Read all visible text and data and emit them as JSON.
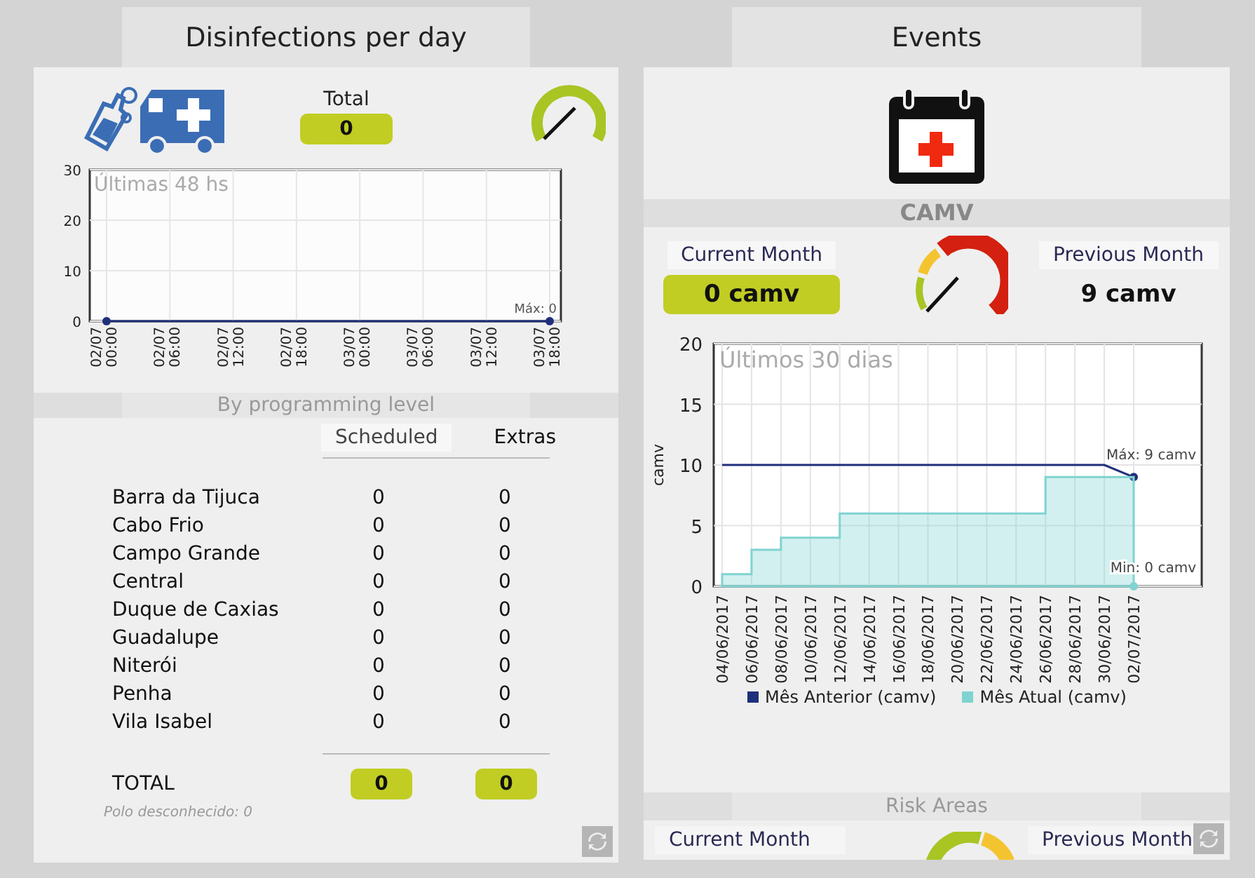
{
  "left_panel": {
    "title": "Disinfections per day",
    "total": {
      "label": "Total",
      "value": "0"
    },
    "chart_data": {
      "type": "line",
      "grid": true,
      "title": "Últimas 48 hs",
      "ylim": [
        0,
        30
      ],
      "yticks": [
        0,
        10,
        20,
        30
      ],
      "categories": [
        "02/07 00:00",
        "02/07 06:00",
        "02/07 12:00",
        "02/07 18:00",
        "03/07 00:00",
        "03/07 06:00",
        "03/07 12:00",
        "03/07 18:00"
      ],
      "series": [
        {
          "color": "#1f2f7a",
          "values": [
            0,
            0,
            0,
            0,
            0,
            0,
            0,
            0
          ]
        }
      ],
      "annotations": [
        "Máx: 0"
      ]
    },
    "section_title": "By programming level",
    "columns": [
      "Scheduled",
      "Extras"
    ],
    "rows": [
      {
        "name": "Barra da Tijuca",
        "scheduled": "0",
        "extras": "0"
      },
      {
        "name": "Cabo Frio",
        "scheduled": "0",
        "extras": "0"
      },
      {
        "name": "Campo Grande",
        "scheduled": "0",
        "extras": "0"
      },
      {
        "name": "Central",
        "scheduled": "0",
        "extras": "0"
      },
      {
        "name": "Duque de Caxias",
        "scheduled": "0",
        "extras": "0"
      },
      {
        "name": "Guadalupe",
        "scheduled": "0",
        "extras": "0"
      },
      {
        "name": "Niterói",
        "scheduled": "0",
        "extras": "0"
      },
      {
        "name": "Penha",
        "scheduled": "0",
        "extras": "0"
      },
      {
        "name": "Vila Isabel",
        "scheduled": "0",
        "extras": "0"
      }
    ],
    "total_row": {
      "label": "TOTAL",
      "scheduled": "0",
      "extras": "0"
    },
    "footnote": "Polo desconhecido: 0"
  },
  "right_panel": {
    "title": "Events",
    "section_title": "CAMV",
    "current": {
      "label": "Current Month",
      "value": "0 camv"
    },
    "previous": {
      "label": "Previous Month",
      "value": "9 camv"
    },
    "chart_data": {
      "type": "area",
      "grid": true,
      "title": "Últimos 30 dias",
      "ylabel": "camv",
      "ylim": [
        0,
        20
      ],
      "yticks": [
        0,
        5,
        10,
        15,
        20
      ],
      "categories": [
        "04/06/2017",
        "06/06/2017",
        "08/06/2017",
        "10/06/2017",
        "12/06/2017",
        "14/06/2017",
        "16/06/2017",
        "18/06/2017",
        "20/06/2017",
        "22/06/2017",
        "24/06/2017",
        "26/06/2017",
        "28/06/2017",
        "30/06/2017",
        "02/07/2017"
      ],
      "series": [
        {
          "name": "Mês Anterior (camv)",
          "type": "line",
          "color": "#1f2f7a",
          "values": [
            10,
            10,
            10,
            10,
            10,
            10,
            10,
            10,
            10,
            10,
            10,
            10,
            10,
            10,
            9
          ]
        },
        {
          "name": "Mês Atual (camv)",
          "type": "area",
          "color": "#7fd3d0",
          "values": [
            1,
            3,
            4,
            4,
            6,
            6,
            6,
            6,
            6,
            6,
            6,
            9,
            9,
            9,
            0
          ]
        }
      ],
      "annotations": [
        "Máx: 9 camv",
        "Min: 0 camv"
      ]
    },
    "risk": {
      "section_title": "Risk Areas",
      "current_label": "Current Month",
      "previous_label": "Previous Month"
    }
  }
}
